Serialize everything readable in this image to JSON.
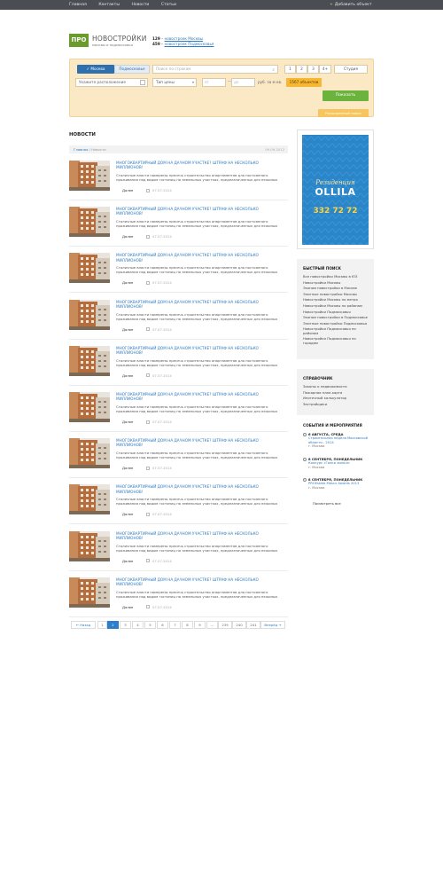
{
  "topbar": {
    "nav": [
      "Главная",
      "Контакты",
      "Новости",
      "Статьи"
    ],
    "add_object": "Добавить объект"
  },
  "logo": {
    "badge": "ПРО",
    "name": "НОВОСТРОЙКИ",
    "tagline": "москвы и подмосковья"
  },
  "stats": {
    "moscow_count": "129",
    "moscow_text": "новостроек Москвы",
    "region_count": "459",
    "region_text": "новостроек Подмосковья",
    "sep": "–"
  },
  "search": {
    "city_tab": "Москва",
    "region_tab": "Подмосковье",
    "placeholder": "Поиск по строкам",
    "rooms": [
      "1",
      "2",
      "3",
      "4+"
    ],
    "studio": "Студия",
    "location": "Укажите расположение",
    "price_type": "Тип цены",
    "from_placeholder": "от",
    "to_placeholder": "до",
    "price_dash": "—",
    "unit": "руб. за м кв.",
    "objects": "1567 объектов",
    "show_button": "Показать",
    "extended_button": "Расширенный поиск"
  },
  "news": {
    "heading": "НОВОСТИ",
    "breadcrumb": [
      "Главная",
      "Новости"
    ],
    "breadcrumb_sep": "/",
    "date": "09.09.2012",
    "more_label": "Далее",
    "items": [
      {
        "title": "Многоквартирный дом на дачном участке? Штраф на несколько миллионов!",
        "text": "Столичные власти намерены пресечь строительство апартаментов для постоянного проживания под видом гостиниц на земельных участках, предназначенных для нежилых",
        "date": "07.07.2014"
      },
      {
        "title": "Многоквартирный дом на дачном участке? Штраф на несколько миллионов!",
        "text": "Столичные власти намерены пресечь строительство апартаментов для постоянного проживания под видом гостиниц на земельных участках, предназначенных для нежилых",
        "date": "07.07.2014"
      },
      {
        "title": "Многоквартирный дом на дачном участке? Штраф на несколько миллионов!",
        "text": "Столичные власти намерены пресечь строительство апартаментов для постоянного проживания под видом гостиниц на земельных участках, предназначенных для нежилых",
        "date": "07.07.2014"
      },
      {
        "title": "Многоквартирный дом на дачном участке? Штраф на несколько миллионов!",
        "text": "Столичные власти намерены пресечь строительство апартаментов для постоянного проживания под видом гостиниц на земельных участках, предназначенных для нежилых",
        "date": "07.07.2014"
      },
      {
        "title": "Многоквартирный дом на дачном участке? Штраф на несколько миллионов!",
        "text": "Столичные власти намерены пресечь строительство апартаментов для постоянного проживания под видом гостиниц на земельных участках, предназначенных для нежилых",
        "date": "07.07.2014"
      },
      {
        "title": "Многоквартирный дом на дачном участке? Штраф на несколько миллионов!",
        "text": "Столичные власти намерены пресечь строительство апартаментов для постоянного проживания под видом гостиниц на земельных участках, предназначенных для нежилых",
        "date": "07.07.2014"
      },
      {
        "title": "Многоквартирный дом на дачном участке? Штраф на несколько миллионов!",
        "text": "Столичные власти намерены пресечь строительство апартаментов для постоянного проживания под видом гостиниц на земельных участках, предназначенных для нежилых",
        "date": "07.07.2014"
      },
      {
        "title": "Многоквартирный дом на дачном участке? Штраф на несколько миллионов!",
        "text": "Столичные власти намерены пресечь строительство апартаментов для постоянного проживания под видом гостиниц на земельных участках, предназначенных для нежилых",
        "date": "07.07.2014"
      },
      {
        "title": "Многоквартирный дом на дачном участке? Штраф на несколько миллионов!",
        "text": "Столичные власти намерены пресечь строительство апартаментов для постоянного проживания под видом гостиниц на земельных участках, предназначенных для нежилых",
        "date": "07.07.2014"
      },
      {
        "title": "Многоквартирный дом на дачном участке? Штраф на несколько миллионов!",
        "text": "Столичные власти намерены пресечь строительство апартаментов для постоянного проживания под видом гостиниц на земельных участках, предназначенных для нежилых",
        "date": "07.07.2014"
      }
    ]
  },
  "pagination": {
    "prev": "← Назад",
    "next": "Вперёд →",
    "pages": [
      "1",
      "2",
      "3",
      "4",
      "5",
      "6",
      "7",
      "8",
      "9",
      "...",
      "239",
      "240",
      "241"
    ],
    "active": "2"
  },
  "banner": {
    "script_text": "Резиденция",
    "brand": "OLLILA",
    "phone": "332 72 72",
    "bg_color": "#2b86c9"
  },
  "quick_search": {
    "title": "БЫСТРЫЙ ПОИСК",
    "links": [
      "Все новостройки Москвы в ЮЗ",
      "Новостройки Москвы",
      "Эконом новостройки в Москве",
      "Элитные новостройки Москвы",
      "Новостройки Москвы по метро",
      "Новостройки Москвы по районам",
      "Новостройки Подмосковья",
      "Эконом новостройки в Подмосковье",
      "Элитные новостройки Подмосковья",
      "Новостройки Подмосковья по районам",
      "Новостройки Подмосковья по городам"
    ]
  },
  "references": {
    "title": "СПРАВОЧНИК",
    "links": [
      "Законы о недвижимости",
      "Пожарная план-карта",
      "Ипотечный калькулятор",
      "Застройщики"
    ]
  },
  "events": {
    "title": "СОБЫТИЯ И МЕРОПРИЯТИЯ",
    "items": [
      {
        "date": "6 АВГУСТА, СРЕДА",
        "name": "Строительная неделя Московской области - 2014",
        "city": "г. Москва"
      },
      {
        "date": "8 СЕНТЯБРЯ, ПОНЕДЕЛЬНИК",
        "name": "Конкурс «Гонки жилья»",
        "city": "г. Москва"
      },
      {
        "date": "8 СЕНТЯБРЯ, ПОНЕДЕЛЬНИК",
        "name": "PROEstate Moscu Awards 2013",
        "city": "г. Москва"
      }
    ],
    "view_all": "Посмотреть все"
  }
}
